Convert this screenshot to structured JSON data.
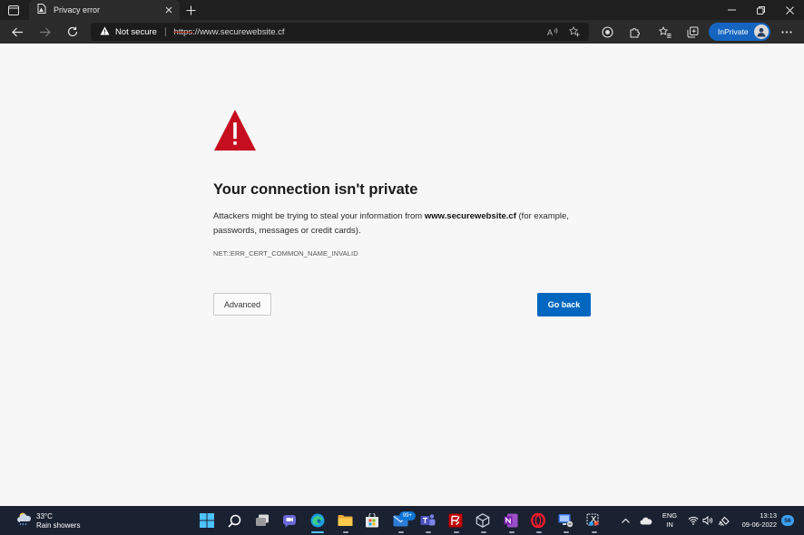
{
  "window": {
    "tab_title": "Privacy error",
    "tab_close_icon": "close-icon",
    "new_tab_icon": "plus-icon"
  },
  "toolbar": {
    "security_label": "Not secure",
    "url_scheme": "https",
    "url_rest": "://www.securewebsite.cf",
    "inprivate_label": "InPrivate"
  },
  "page": {
    "headline": "Your connection isn't private",
    "desc_before": "Attackers might be trying to steal your information from ",
    "desc_host": "www.securewebsite.cf",
    "desc_after": " (for example, passwords, messages or credit cards).",
    "error_code": "NET::ERR_CERT_COMMON_NAME_INVALID",
    "advanced_label": "Advanced",
    "back_label": "Go back",
    "warning_color": "#c50f1f",
    "primary_color": "#0067c0"
  },
  "taskbar": {
    "weather_temp": "33°C",
    "weather_desc": "Rain showers",
    "mail_badge": "99+",
    "lang_line1": "ENG",
    "lang_line2": "IN",
    "time": "13:13",
    "date": "09-06-2022",
    "notification_count": "56"
  }
}
